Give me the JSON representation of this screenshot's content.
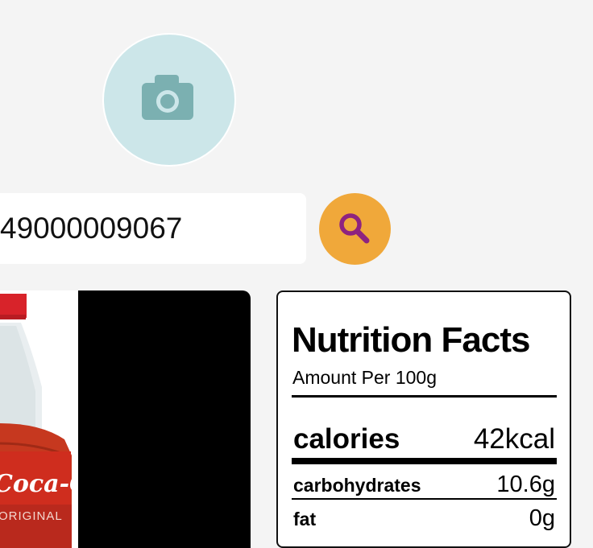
{
  "camera": {
    "icon": "camera-icon",
    "bg_color": "#cce6e9",
    "icon_color": "#7bb0b1"
  },
  "barcode": {
    "value": "49000009067"
  },
  "search": {
    "icon": "search-icon",
    "bg_color": "#f0a83a",
    "icon_color": "#8e2380"
  },
  "product_image": {
    "brand_text": "Coca-Cola",
    "label_text": "ORIGINAL"
  },
  "nutrition": {
    "title": "Nutrition Facts",
    "serving": "Amount Per 100g",
    "rows": [
      {
        "label": "calories",
        "value": "42kcal"
      },
      {
        "label": "carbohydrates",
        "value": "10.6g"
      },
      {
        "label": "fat",
        "value": "0g"
      }
    ]
  }
}
